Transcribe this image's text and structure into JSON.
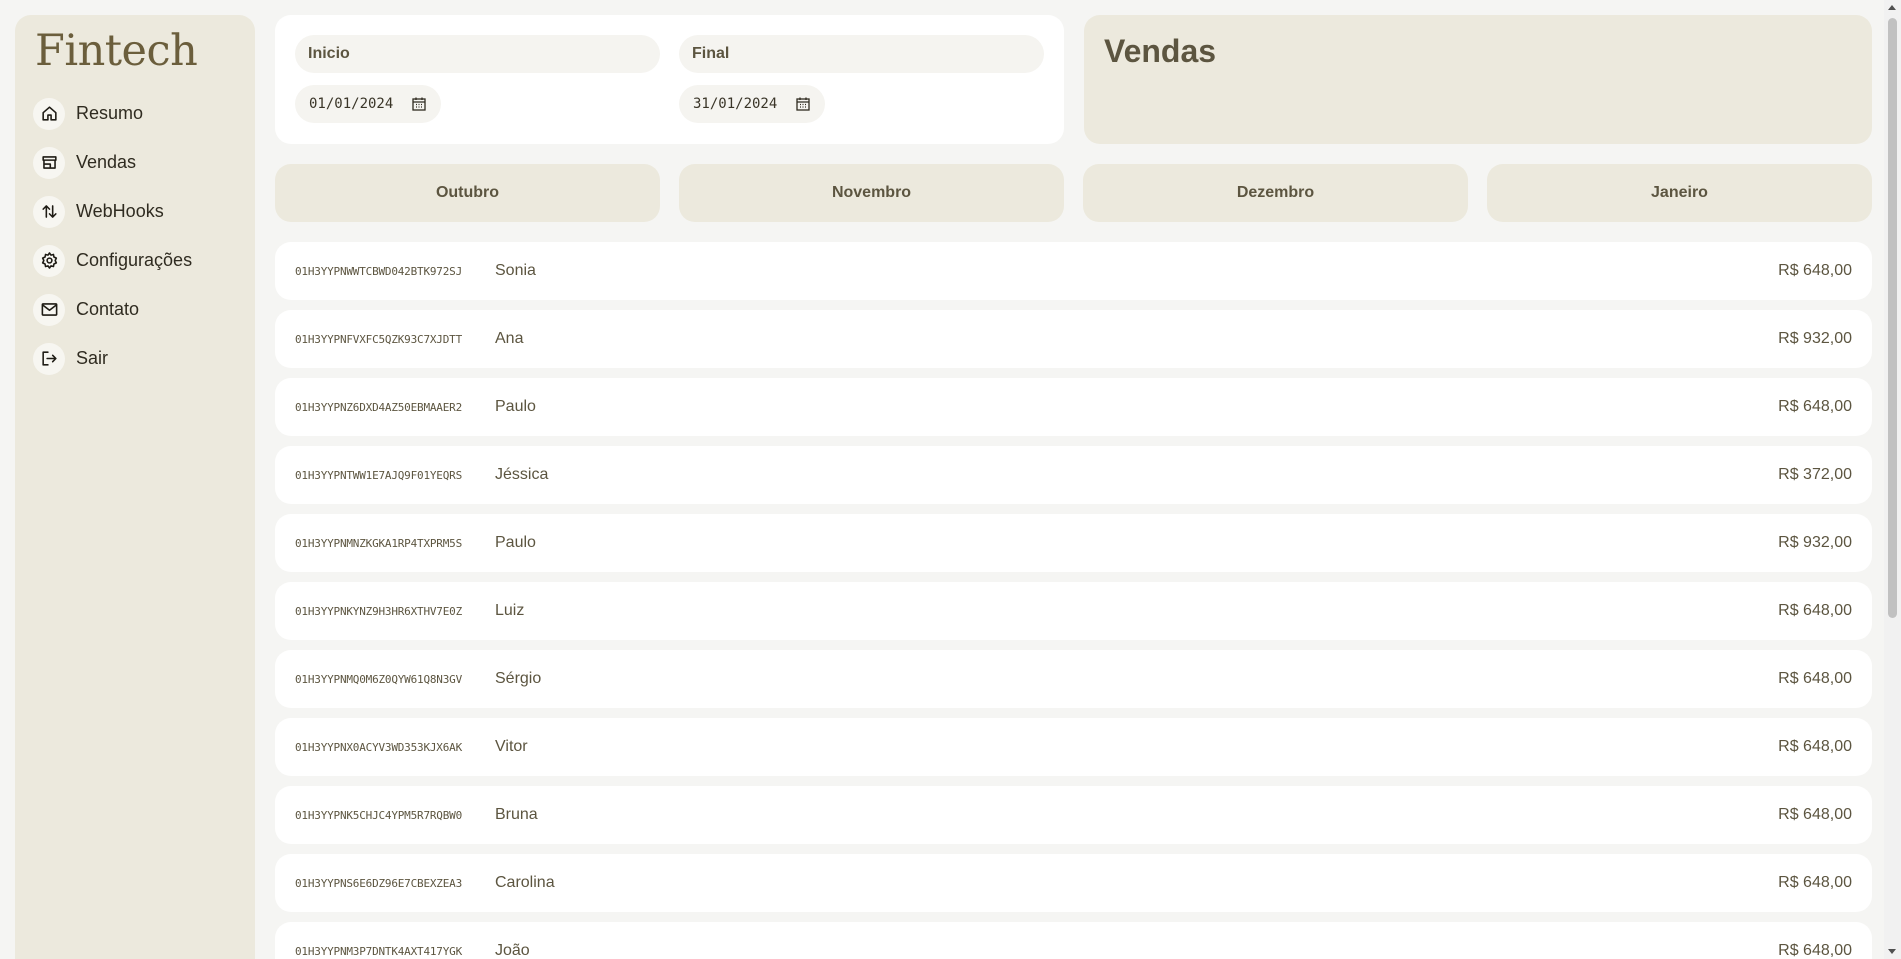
{
  "app": {
    "logo": "Fintech"
  },
  "sidebar": {
    "items": [
      {
        "label": "Resumo",
        "icon": "home-icon"
      },
      {
        "label": "Vendas",
        "icon": "store-icon"
      },
      {
        "label": "WebHooks",
        "icon": "arrows-swap-icon"
      },
      {
        "label": "Configurações",
        "icon": "gear-icon"
      },
      {
        "label": "Contato",
        "icon": "mail-icon"
      },
      {
        "label": "Sair",
        "icon": "logout-icon"
      }
    ]
  },
  "filters": {
    "start": {
      "label": "Inicio",
      "value": "01/01/2024"
    },
    "end": {
      "label": "Final",
      "value": "31/01/2024"
    }
  },
  "page": {
    "title": "Vendas"
  },
  "months": [
    "Outubro",
    "Novembro",
    "Dezembro",
    "Janeiro"
  ],
  "sales": [
    {
      "id": "01H3YYPNWWTCBWD042BTK972SJ",
      "name": "Sonia",
      "price": "R$ 648,00"
    },
    {
      "id": "01H3YYPNFVXFC5QZK93C7XJDTT",
      "name": "Ana",
      "price": "R$ 932,00"
    },
    {
      "id": "01H3YYPNZ6DXD4AZ50EBMAAER2",
      "name": "Paulo",
      "price": "R$ 648,00"
    },
    {
      "id": "01H3YYPNTWW1E7AJQ9F01YEQRS",
      "name": "Jéssica",
      "price": "R$ 372,00"
    },
    {
      "id": "01H3YYPNMNZKGKA1RP4TXPRM5S",
      "name": "Paulo",
      "price": "R$ 932,00"
    },
    {
      "id": "01H3YYPNKYNZ9H3HR6XTHV7E0Z",
      "name": "Luiz",
      "price": "R$ 648,00"
    },
    {
      "id": "01H3YYPNMQ0M6Z0QYW61Q8N3GV",
      "name": "Sérgio",
      "price": "R$ 648,00"
    },
    {
      "id": "01H3YYPNX0ACYV3WD353KJX6AK",
      "name": "Vitor",
      "price": "R$ 648,00"
    },
    {
      "id": "01H3YYPNK5CHJC4YPM5R7RQBW0",
      "name": "Bruna",
      "price": "R$ 648,00"
    },
    {
      "id": "01H3YYPNS6E6DZ96E7CBEXZEA3",
      "name": "Carolina",
      "price": "R$ 648,00"
    },
    {
      "id": "01H3YYPNM3P7DNTK4AXT417YGK",
      "name": "João",
      "price": "R$ 648,00"
    }
  ]
}
